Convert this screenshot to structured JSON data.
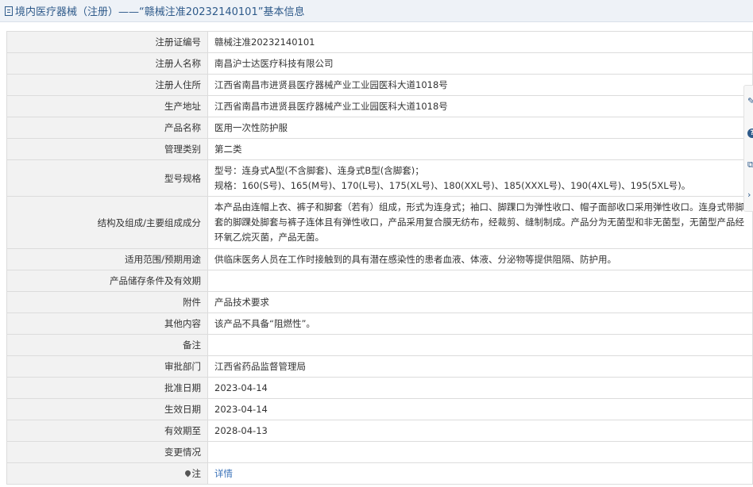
{
  "header": {
    "title": "境内医疗器械（注册）——“赣械注准20232140101”基本信息"
  },
  "rows": [
    {
      "label": "注册证编号",
      "value": "赣械注准20232140101"
    },
    {
      "label": "注册人名称",
      "value": "南昌沪士达医疗科技有限公司"
    },
    {
      "label": "注册人住所",
      "value": "江西省南昌市进贤县医疗器械产业工业园医科大道1018号"
    },
    {
      "label": "生产地址",
      "value": "江西省南昌市进贤县医疗器械产业工业园医科大道1018号"
    },
    {
      "label": "产品名称",
      "value": "医用一次性防护服"
    },
    {
      "label": "管理类别",
      "value": "第二类"
    },
    {
      "label": "型号规格",
      "value_line1": "型号：连身式A型(不含脚套)、连身式B型(含脚套)；",
      "value_line2": "规格：160(S号)、165(M号)、170(L号)、175(XL号)、180(XXL号)、185(XXXL号)、190(4XL号)、195(5XL号)。"
    },
    {
      "label": "结构及组成/主要组成成分",
      "value": "本产品由连帽上衣、裤子和脚套（若有）组成，形式为连身式；袖口、脚踝口为弹性收口、帽子面部收口采用弹性收口。连身式带脚套的脚踝处脚套与裤子连体且有弹性收口，产品采用复合膜无纺布，经裁剪、缝制制成。产品分为无菌型和非无菌型，无菌型产品经环氧乙烷灭菌，产品无菌。"
    },
    {
      "label": "适用范围/预期用途",
      "value": "供临床医务人员在工作时接触到的具有潜在感染性的患者血液、体液、分泌物等提供阻隔、防护用。"
    },
    {
      "label": "产品储存条件及有效期",
      "value": ""
    },
    {
      "label": "附件",
      "value": "产品技术要求"
    },
    {
      "label": "其他内容",
      "value": "该产品不具备“阻燃性”。"
    },
    {
      "label": "备注",
      "value": ""
    },
    {
      "label": "审批部门",
      "value": "江西省药品监督管理局"
    },
    {
      "label": "批准日期",
      "value": "2023-04-14"
    },
    {
      "label": "生效日期",
      "value": "2023-04-14"
    },
    {
      "label": "有效期至",
      "value": "2028-04-13"
    },
    {
      "label": "变更情况",
      "value": ""
    },
    {
      "label": "注",
      "value": "详情"
    }
  ],
  "icons": {
    "header": "document-icon",
    "note": "pin-icon",
    "side": [
      "edit-icon",
      "help-icon",
      "copy-icon",
      "collapse-icon"
    ]
  },
  "side_tools": {
    "help_glyph": "?",
    "collapse_glyph": "›"
  },
  "colors": {
    "label_bg": "#f2f2f2",
    "border": "#dcdcdc",
    "header_bg": "#eef2f7",
    "title_color": "#2e5a8a",
    "link_color": "#3a72b8"
  }
}
